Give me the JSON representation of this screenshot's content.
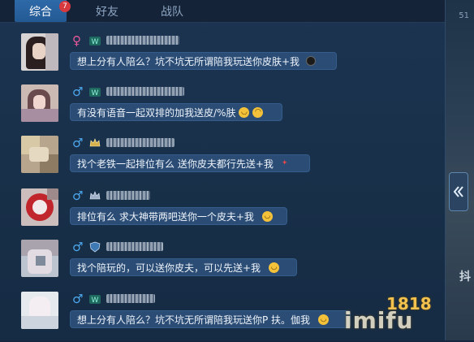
{
  "tabs": [
    {
      "label": "综合",
      "active": true,
      "badge": "7"
    },
    {
      "label": "好友",
      "active": false
    },
    {
      "label": "战队",
      "active": false
    }
  ],
  "backdrop": {
    "corner_text": "51",
    "side_glyph": "抖"
  },
  "messages": [
    {
      "gender": "♀",
      "gender_type": "female",
      "rank_icon": "rank-w-green-icon",
      "text": "想上分有人陪么？坑不坑无所谓陪我玩送你皮肤+我",
      "emojis": [
        "bomb-emoji-icon"
      ]
    },
    {
      "gender": "♂",
      "gender_type": "male",
      "rank_icon": "rank-w-green-icon",
      "text": "有没有语音一起双排的加我送皮/%肤",
      "emojis": [
        "grin-emoji-icon",
        "smug-emoji-icon"
      ]
    },
    {
      "gender": "♂",
      "gender_type": "male",
      "rank_icon": "rank-crown-gold-icon",
      "text": "找个老铁一起排位有么 送你皮夫都行先送+我",
      "emojis": [
        "star-emoji-icon"
      ]
    },
    {
      "gender": "♂",
      "gender_type": "male",
      "rank_icon": "rank-crown-silver-icon",
      "text": "排位有么 求大神带两吧送你一个皮夫+我",
      "emojis": [
        "smile-emoji-icon"
      ]
    },
    {
      "gender": "♂",
      "gender_type": "male",
      "rank_icon": "rank-shield-icon",
      "text": "找个陪玩的，可以送你皮夫，可以先送+我",
      "emojis": [
        "laugh-emoji-icon"
      ]
    },
    {
      "gender": "♂",
      "gender_type": "male",
      "rank_icon": "rank-w-green-icon",
      "text": "想上分有人陪么？坑不坑无所谓陪我玩送你P 扶。伽我",
      "emojis": [
        "smile-emoji-icon"
      ]
    }
  ],
  "watermark": {
    "main": "imifu",
    "sub": "1818"
  },
  "colors": {
    "panel_bg": "#1a3150",
    "bubble_bg": "#2b4d75",
    "tab_active": "#2a63a0",
    "female": "#e8589a",
    "male": "#4da8ee"
  }
}
